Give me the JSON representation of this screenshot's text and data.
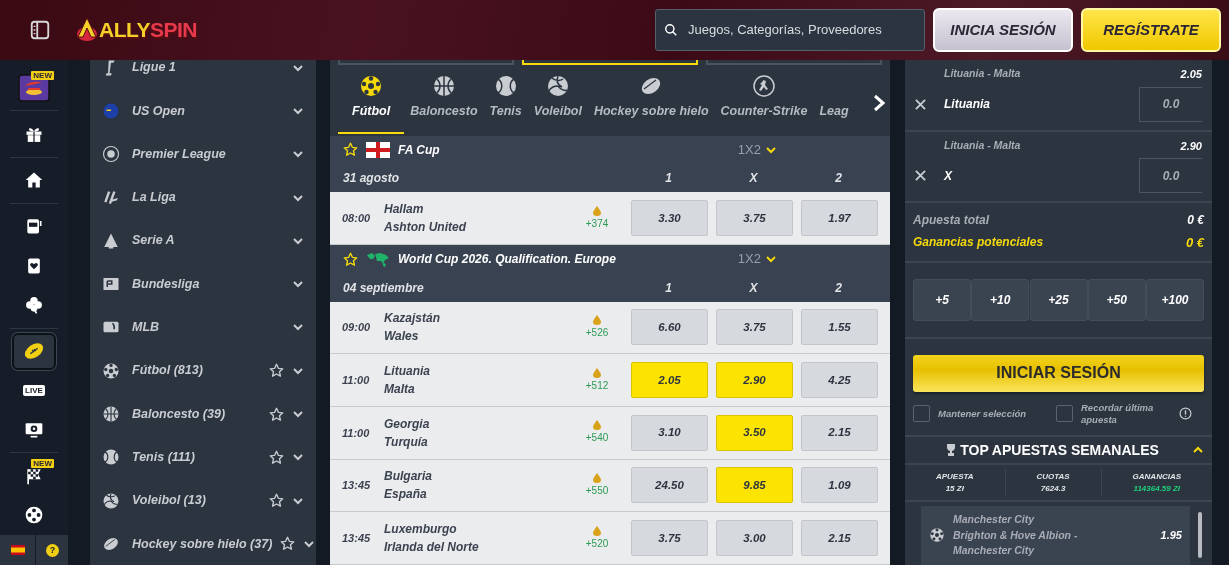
{
  "header": {
    "logo": {
      "first": "ALLY",
      "second": "SPIN"
    },
    "search": {
      "placeholder": "Juegos, Categorías, Proveedores"
    },
    "login_button": "INICIA SESIÓN",
    "register_button": "REGÍSTRATE"
  },
  "rail": {
    "groups": [
      [
        {
          "kind": "promo",
          "badge": "NEW",
          "selected": false
        }
      ],
      [
        {
          "kind": "gift",
          "selected": false
        }
      ],
      [
        {
          "kind": "home",
          "selected": false
        }
      ],
      [
        {
          "kind": "slot",
          "selected": false
        },
        {
          "kind": "card",
          "selected": false
        },
        {
          "kind": "clover",
          "selected": false
        }
      ],
      [
        {
          "kind": "rugby",
          "selected": true
        },
        {
          "kind": "live",
          "label": "LIVE",
          "selected": false
        },
        {
          "kind": "tv",
          "selected": false
        }
      ],
      [
        {
          "kind": "flag",
          "badge": "NEW",
          "selected": false
        },
        {
          "kind": "reel",
          "selected": false
        }
      ]
    ],
    "help": "?"
  },
  "sidebar": {
    "items": [
      {
        "label": "Ligue 1",
        "kind": "ligue"
      },
      {
        "label": "US Open",
        "kind": "usopen"
      },
      {
        "label": "Premier League",
        "kind": "premier"
      },
      {
        "label": "La Liga",
        "kind": "laliga"
      },
      {
        "label": "Serie A",
        "kind": "seriea"
      },
      {
        "label": "Bundesliga",
        "kind": "bundesliga"
      },
      {
        "label": "MLB",
        "kind": "mlb"
      },
      {
        "label": "Fútbol (813)",
        "kind": "football",
        "favorite": false
      },
      {
        "label": "Baloncesto (39)",
        "kind": "basketball",
        "favorite": false
      },
      {
        "label": "Tenis (111)",
        "kind": "tennis",
        "favorite": false
      },
      {
        "label": "Voleibol (13)",
        "kind": "volleyball",
        "favorite": false
      },
      {
        "label": "Hockey sobre hielo (37)",
        "kind": "hockey",
        "favorite": false
      }
    ]
  },
  "section_tabs": [
    {
      "selected": false
    },
    {
      "selected": true
    },
    {
      "selected": false
    }
  ],
  "sport_tabs": [
    {
      "label": "Fútbol",
      "kind": "football",
      "selected": true
    },
    {
      "label": "Baloncesto",
      "kind": "basketball",
      "selected": false
    },
    {
      "label": "Tenis",
      "kind": "tennis",
      "selected": false
    },
    {
      "label": "Voleibol",
      "kind": "volleyball",
      "selected": false
    },
    {
      "label": "Hockey sobre hielo",
      "kind": "hockey",
      "selected": false
    },
    {
      "label": "Counter-Strike",
      "kind": "cs",
      "selected": false
    },
    {
      "label": "Leag",
      "kind": "none",
      "selected": false
    }
  ],
  "event_groups": [
    {
      "league": "FA Cup",
      "kind": "england",
      "favorite": false,
      "market": "1X2",
      "date": "31 agosto",
      "columns": [
        "1",
        "X",
        "2"
      ],
      "matches": [
        {
          "time": "08:00",
          "home": "Hallam",
          "away": "Ashton United",
          "more": "+374",
          "odds": [
            {
              "value": "3.30",
              "selected": false
            },
            {
              "value": "3.75",
              "selected": false
            },
            {
              "value": "1.97",
              "selected": false
            }
          ]
        }
      ]
    },
    {
      "league": "World Cup 2026. Qualification. Europe",
      "kind": "world",
      "favorite": false,
      "market": "1X2",
      "date": "04 septiembre",
      "columns": [
        "1",
        "X",
        "2"
      ],
      "matches": [
        {
          "time": "09:00",
          "home": "Kazajstán",
          "away": "Wales",
          "more": "+526",
          "odds": [
            {
              "value": "6.60",
              "selected": false
            },
            {
              "value": "3.75",
              "selected": false
            },
            {
              "value": "1.55",
              "selected": false
            }
          ]
        },
        {
          "time": "11:00",
          "home": "Lituania",
          "away": "Malta",
          "more": "+512",
          "odds": [
            {
              "value": "2.05",
              "selected": true
            },
            {
              "value": "2.90",
              "selected": true
            },
            {
              "value": "4.25",
              "selected": false
            }
          ]
        },
        {
          "time": "11:00",
          "home": "Georgia",
          "away": "Turquía",
          "more": "+540",
          "odds": [
            {
              "value": "3.10",
              "selected": false
            },
            {
              "value": "3.50",
              "selected": true
            },
            {
              "value": "2.15",
              "selected": false
            }
          ]
        },
        {
          "time": "13:45",
          "home": "Bulgaria",
          "away": "España",
          "more": "+550",
          "odds": [
            {
              "value": "24.50",
              "selected": false
            },
            {
              "value": "9.85",
              "selected": true
            },
            {
              "value": "1.09",
              "selected": false
            }
          ]
        },
        {
          "time": "13:45",
          "home": "Luxemburgo",
          "away": "Irlanda del Norte",
          "more": "+520",
          "odds": [
            {
              "value": "3.75",
              "selected": false
            },
            {
              "value": "3.00",
              "selected": false
            },
            {
              "value": "2.15",
              "selected": false
            }
          ]
        }
      ]
    }
  ],
  "bet_slip": {
    "selections": [
      {
        "event": "Lituania - Malta",
        "pick": "Lituania",
        "odds": "2.05",
        "stake_placeholder": "0.0"
      },
      {
        "event": "Lituania - Malta",
        "pick": "X",
        "odds": "2.90",
        "stake_placeholder": "0.0"
      }
    ],
    "total": {
      "label": "Apuesta total",
      "value": "0 €"
    },
    "potential": {
      "label": "Ganancias potenciales",
      "value": "0 €"
    },
    "quick_stakes": [
      "+5",
      "+10",
      "+25",
      "+50",
      "+100"
    ],
    "login_button": "INICIAR SESIÓN",
    "options": [
      {
        "label": "Mantener selección",
        "checked": false
      },
      {
        "label": "Recordar última apuesta",
        "checked": false
      }
    ]
  },
  "top_bets": {
    "title": "TOP APUESTAS SEMANALES",
    "expanded": true,
    "stats": [
      {
        "label": "APUESTA",
        "value": "15 Zł"
      },
      {
        "label": "CUOTAS",
        "value": "7624.3"
      },
      {
        "label": "GANANCIAS",
        "value": "114364.59 Zł"
      }
    ],
    "bets": [
      {
        "pick": "Manchester City",
        "event": "Brighton & Hove Albion - Manchester City",
        "odds": "1.95"
      }
    ]
  }
}
